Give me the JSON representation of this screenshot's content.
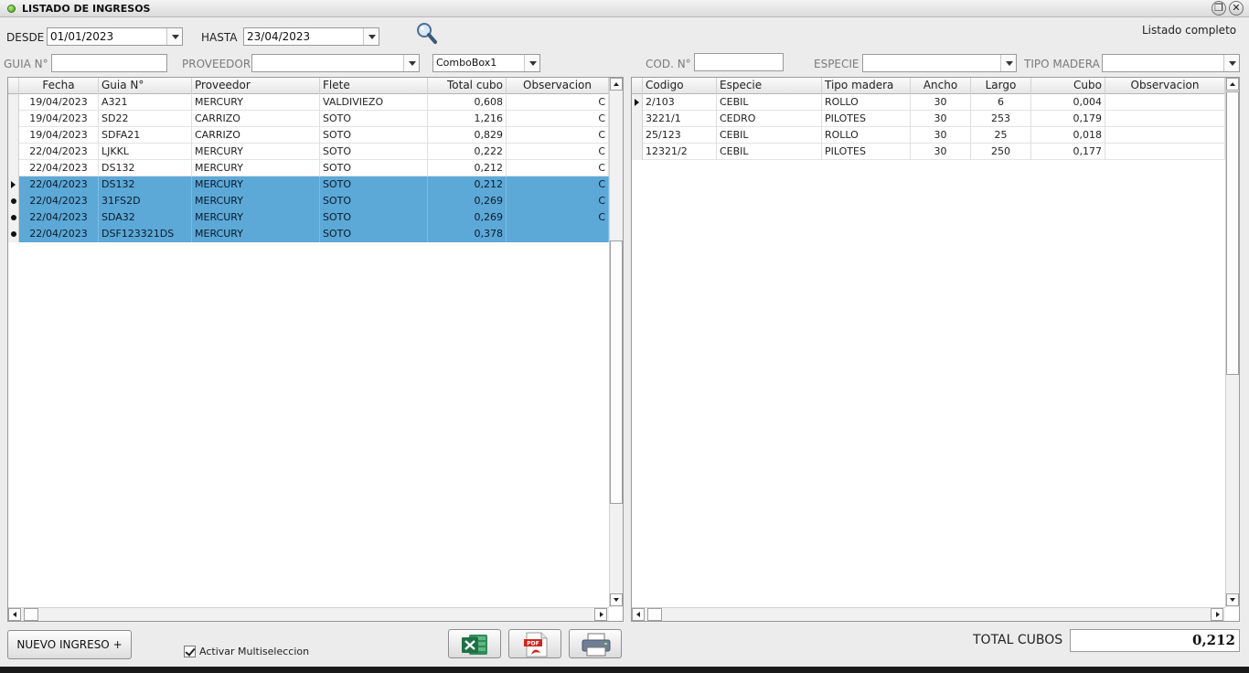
{
  "window": {
    "title": "LISTADO DE INGRESOS"
  },
  "filters": {
    "desde_label": "DESDE",
    "desde_value": "01/01/2023",
    "hasta_label": "HASTA",
    "hasta_value": "23/04/2023",
    "guia_label": "GUIA N°",
    "guia_value": "",
    "proveedor_label": "PROVEEDOR",
    "proveedor_value": "",
    "combo1_value": "ComboBox1",
    "listado_label": "Listado completo",
    "cod_label": "COD. N°",
    "cod_value": "",
    "especie_label": "ESPECIE",
    "especie_value": "",
    "tipo_madera_label": "TIPO MADERA",
    "tipo_madera_value": ""
  },
  "ingresos": {
    "columns": [
      "Fecha",
      "Guia N°",
      "Proveedor",
      "Flete",
      "Total cubo",
      "Observacion"
    ],
    "rows": [
      [
        "19/04/2023",
        "A321",
        "MERCURY",
        "VALDIVIEZO",
        "0,608",
        "C"
      ],
      [
        "19/04/2023",
        "SD22",
        "CARRIZO",
        "SOTO",
        "1,216",
        "C"
      ],
      [
        "19/04/2023",
        "SDFA21",
        "CARRIZO",
        "SOTO",
        "0,829",
        "C"
      ],
      [
        "22/04/2023",
        "LJKKL",
        "MERCURY",
        "SOTO",
        "0,222",
        "C"
      ],
      [
        "22/04/2023",
        "DS132",
        "MERCURY",
        "SOTO",
        "0,212",
        "C"
      ],
      [
        "22/04/2023",
        "DS132",
        "MERCURY",
        "SOTO",
        "0,212",
        "C"
      ],
      [
        "22/04/2023",
        "31FS2D",
        "MERCURY",
        "SOTO",
        "0,269",
        "C"
      ],
      [
        "22/04/2023",
        "SDA32",
        "MERCURY",
        "SOTO",
        "0,269",
        "C"
      ],
      [
        "22/04/2023",
        "DSF123321DS",
        "MERCURY",
        "SOTO",
        "0,378",
        ""
      ]
    ]
  },
  "detalle": {
    "columns": [
      "Codigo",
      "Especie",
      "Tipo madera",
      "Ancho",
      "Largo",
      "Cubo",
      "Observacion"
    ],
    "rows": [
      [
        "2/103",
        "CEBIL",
        "ROLLO",
        "30",
        "6",
        "0,004",
        ""
      ],
      [
        "3221/1",
        "CEDRO",
        "PILOTES",
        "30",
        "253",
        "0,179",
        ""
      ],
      [
        "25/123",
        "CEBIL",
        "ROLLO",
        "30",
        "25",
        "0,018",
        ""
      ],
      [
        "12321/2",
        "CEBIL",
        "PILOTES",
        "30",
        "250",
        "0,177",
        ""
      ]
    ]
  },
  "footer": {
    "nuevo_label": "NUEVO INGRESO +",
    "multisel_label": "Activar Multiseleccion",
    "total_label": "TOTAL CUBOS",
    "total_value": "0,212"
  },
  "icons": {
    "search": "magnifier-icon",
    "excel": "excel-icon",
    "pdf": "pdf-icon",
    "print": "printer-icon"
  },
  "colors": {
    "selection": "#5ca9d8",
    "excel": "#1e7145",
    "pdf": "#d4241c"
  }
}
